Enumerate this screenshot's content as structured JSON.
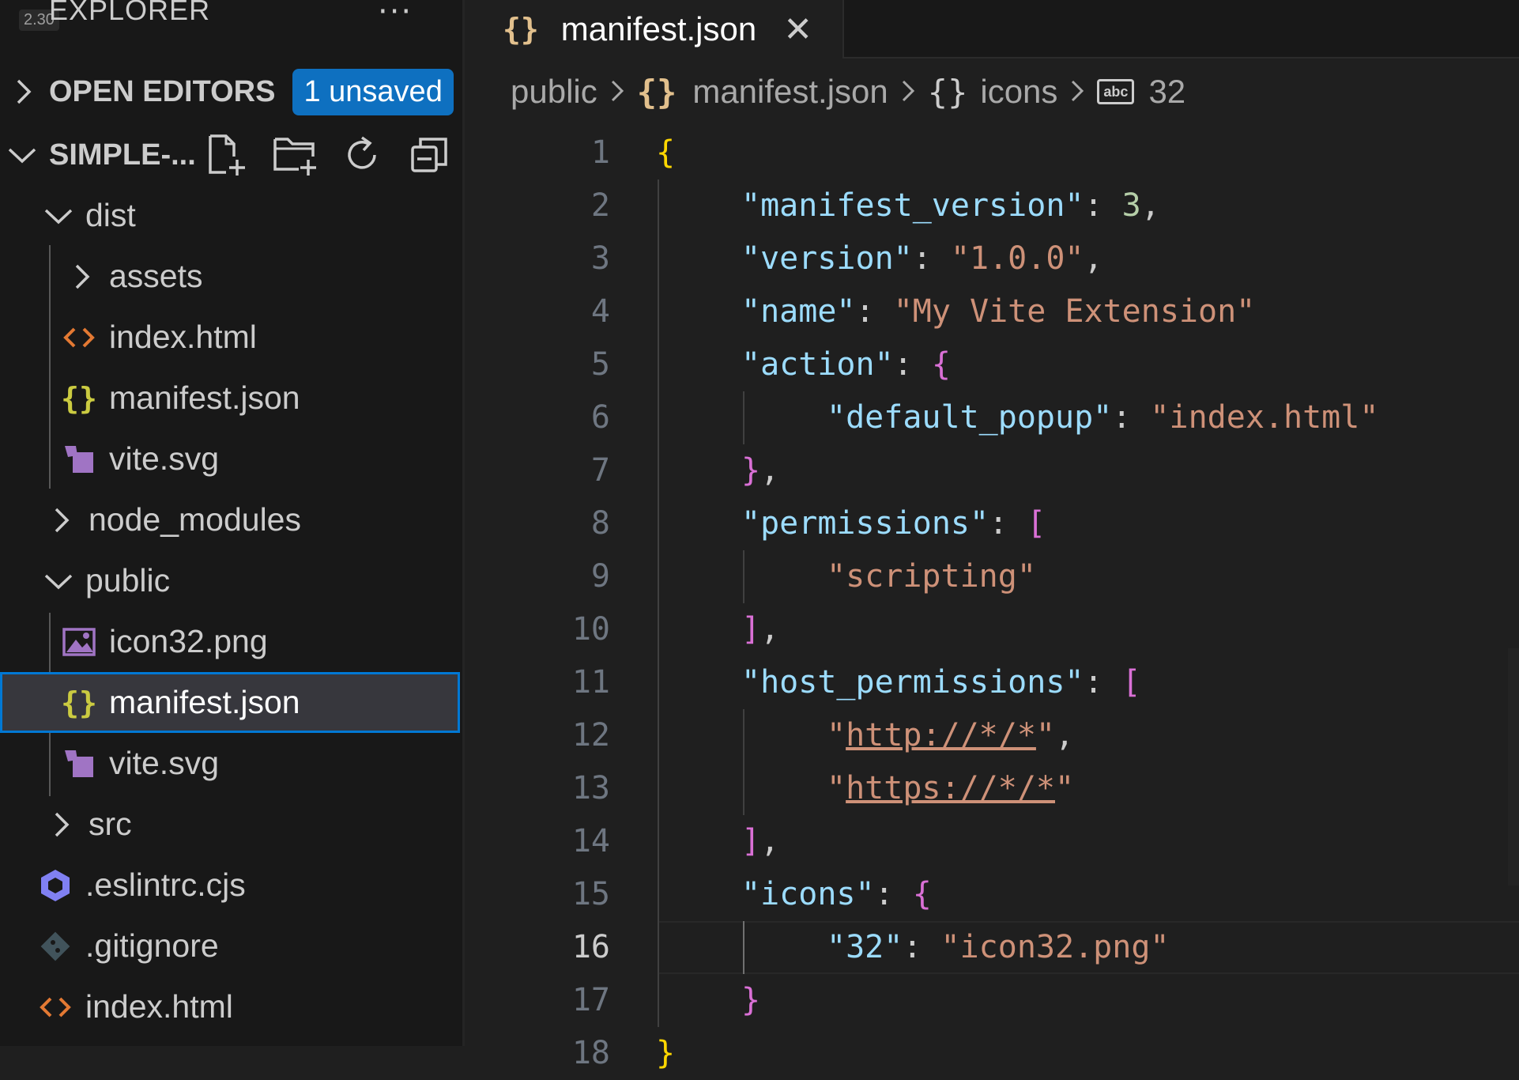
{
  "sidebar": {
    "version_badge": "2.30",
    "title": "EXPLORER",
    "more": "···",
    "open_editors": {
      "label": "OPEN EDITORS",
      "badge": "1 unsaved"
    },
    "project": {
      "label": "SIMPLE-..."
    },
    "tree": [
      {
        "label": "dist",
        "kind": "folder-open",
        "icon": "chevron-down-icon"
      },
      {
        "label": "assets",
        "kind": "folder-closed",
        "icon": "chevron-right-icon"
      },
      {
        "label": "index.html",
        "kind": "file",
        "icon": "html-file-icon"
      },
      {
        "label": "manifest.json",
        "kind": "file",
        "icon": "json-file-icon"
      },
      {
        "label": "vite.svg",
        "kind": "file",
        "icon": "svg-file-icon"
      },
      {
        "label": "node_modules",
        "kind": "folder-closed",
        "icon": "chevron-right-icon"
      },
      {
        "label": "public",
        "kind": "folder-open",
        "icon": "chevron-down-icon"
      },
      {
        "label": "icon32.png",
        "kind": "file",
        "icon": "image-file-icon"
      },
      {
        "label": "manifest.json",
        "kind": "file",
        "icon": "json-file-icon",
        "selected": true
      },
      {
        "label": "vite.svg",
        "kind": "file",
        "icon": "svg-file-icon"
      },
      {
        "label": "src",
        "kind": "folder-closed",
        "icon": "chevron-right-icon"
      },
      {
        "label": ".eslintrc.cjs",
        "kind": "file",
        "icon": "eslint-file-icon"
      },
      {
        "label": ".gitignore",
        "kind": "file",
        "icon": "git-file-icon"
      },
      {
        "label": "index.html",
        "kind": "file",
        "icon": "html-file-icon"
      }
    ]
  },
  "editor": {
    "tab": {
      "icon": "{}",
      "label": "manifest.json",
      "close": "✕"
    },
    "breadcrumb": {
      "folder": "public",
      "file": "manifest.json",
      "object": "icons",
      "key": "32",
      "abc": "abc"
    },
    "lines": [
      {
        "n": "1",
        "text": "{"
      },
      {
        "n": "2",
        "text": "\"manifest_version\": 3,"
      },
      {
        "n": "3",
        "text": "\"version\": \"1.0.0\","
      },
      {
        "n": "4",
        "text": "\"name\": \"My Vite Extension\""
      },
      {
        "n": "5",
        "text": "\"action\": {"
      },
      {
        "n": "6",
        "text": "\"default_popup\": \"index.html\""
      },
      {
        "n": "7",
        "text": "},"
      },
      {
        "n": "8",
        "text": "\"permissions\": ["
      },
      {
        "n": "9",
        "text": "\"scripting\""
      },
      {
        "n": "10",
        "text": "],"
      },
      {
        "n": "11",
        "text": "\"host_permissions\": ["
      },
      {
        "n": "12",
        "text": "\"http://*/*\","
      },
      {
        "n": "13",
        "text": "\"https://*/*\""
      },
      {
        "n": "14",
        "text": "],"
      },
      {
        "n": "15",
        "text": "\"icons\": {"
      },
      {
        "n": "16",
        "text": "\"32\": \"icon32.png\"",
        "current": true
      },
      {
        "n": "17",
        "text": "}"
      },
      {
        "n": "18",
        "text": "}"
      }
    ]
  },
  "colors": {
    "key": "#9cdcfe",
    "string": "#ce9178",
    "number": "#b5cea8",
    "bracket_level1": "#ffd700",
    "bracket_level2": "#da70d6",
    "bracket_level3": "#179fff",
    "badge": "#0e70c0",
    "selection_border": "#0078d4"
  }
}
